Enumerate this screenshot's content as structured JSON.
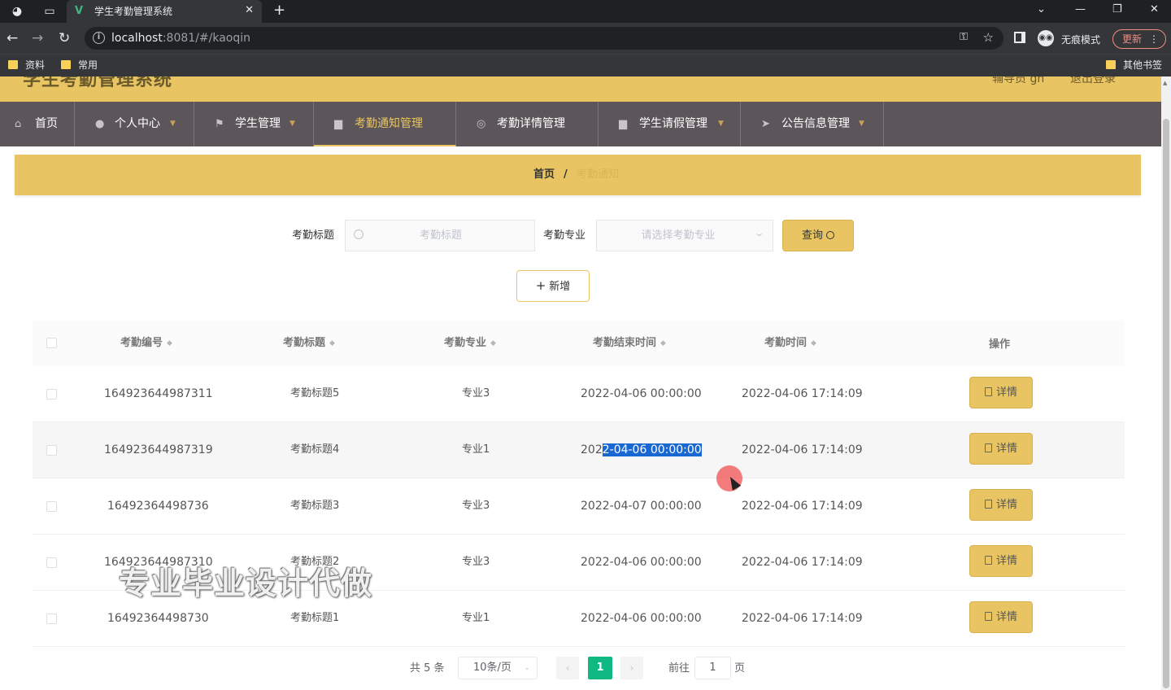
{
  "browser": {
    "tab_title": "学生考勤管理系统",
    "url_host": "localhost",
    "url_rest": ":8081/#/kaoqin",
    "incognito_label": "无痕模式",
    "update_label": "更新",
    "bookmarks": [
      "资料",
      "常用"
    ],
    "other_bookmarks": "其他书签"
  },
  "app": {
    "title": "学生考勤管理系统",
    "user_text": "辅导员 gn",
    "logout": "退出登录"
  },
  "menu": [
    {
      "label": "首页",
      "icon": "home-icon"
    },
    {
      "label": "个人中心",
      "icon": "user-icon"
    },
    {
      "label": "学生管理",
      "icon": "flag-icon"
    },
    {
      "label": "考勤通知管理",
      "icon": "monitor-icon"
    },
    {
      "label": "考勤详情管理",
      "icon": "compass-icon"
    },
    {
      "label": "学生请假管理",
      "icon": "monitor-icon"
    },
    {
      "label": "公告信息管理",
      "icon": "send-icon"
    }
  ],
  "breadcrumb": {
    "home": "首页",
    "separator": "/",
    "current": "考勤通知"
  },
  "search": {
    "title_label": "考勤标题",
    "title_placeholder": "考勤标题",
    "major_label": "考勤专业",
    "major_placeholder": "请选择考勤专业",
    "query_button": "查询"
  },
  "add_button": "新增",
  "table": {
    "headers": [
      "考勤编号",
      "考勤标题",
      "考勤专业",
      "考勤结束时间",
      "考勤时间",
      "操作"
    ],
    "rows": [
      {
        "id": "164923644987311",
        "title": "考勤标题5",
        "major": "专业3",
        "end_time": "2022-04-06 00:00:00",
        "time": "2022-04-06 17:14:09"
      },
      {
        "id": "164923644987319",
        "title": "考勤标题4",
        "major": "专业1",
        "end_time": "2022-04-06 00:00:00",
        "end_time_a": "202",
        "end_time_b": "2-04-06 00:00:00",
        "time": "2022-04-06 17:14:09"
      },
      {
        "id": "16492364498736",
        "title": "考勤标题3",
        "major": "专业3",
        "end_time": "2022-04-07 00:00:00",
        "time": "2022-04-06 17:14:09"
      },
      {
        "id": "164923644987310",
        "title": "考勤标题2",
        "major": "专业3",
        "end_time": "2022-04-06 00:00:00",
        "time": "2022-04-06 17:14:09"
      },
      {
        "id": "16492364498730",
        "title": "考勤标题1",
        "major": "专业1",
        "end_time": "2022-04-06 00:00:00",
        "time": "2022-04-06 17:14:09"
      }
    ],
    "detail_button": "详情"
  },
  "pagination": {
    "total": "共 5 条",
    "page_size": "10条/页",
    "current_page": "1",
    "goto_label": "前往",
    "goto_value": "1",
    "page_unit": "页"
  },
  "watermark": "专业毕业设计代做"
}
